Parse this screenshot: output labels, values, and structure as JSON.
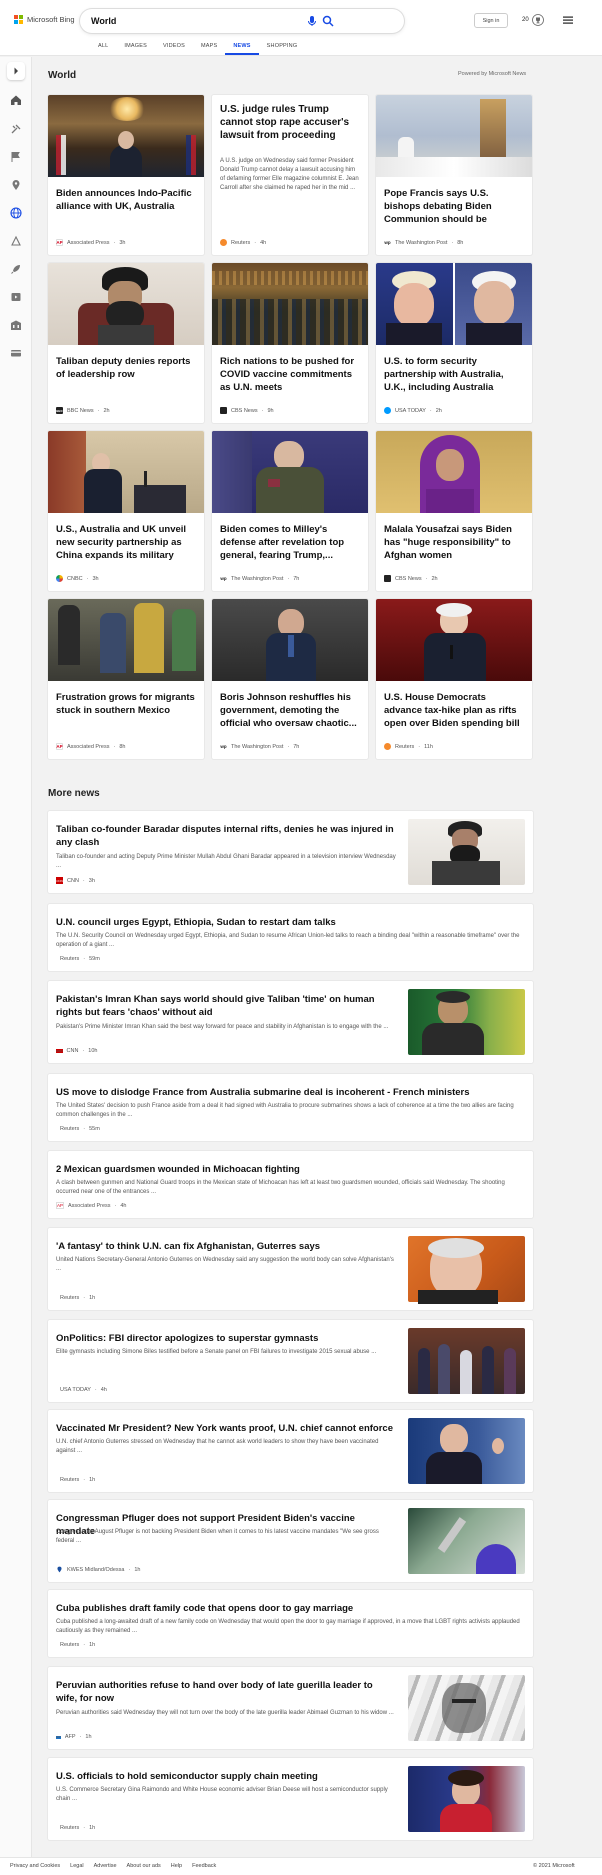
{
  "header": {
    "logo_text": "Microsoft Bing",
    "search_query": "World",
    "signin_label": "Sign in",
    "points": "20",
    "tabs": [
      "ALL",
      "IMAGES",
      "VIDEOS",
      "MAPS",
      "NEWS",
      "SHOPPING"
    ],
    "active_tab": "NEWS"
  },
  "world": {
    "title": "World",
    "powered_by": "Powered by Microsoft News",
    "cards": [
      {
        "title": "Biden announces Indo-Pacific alliance with UK, Australia",
        "source": "Associated Press",
        "age": "3h",
        "logo": "AP",
        "logo_color": "#d6001c",
        "image": "press-conference-photo"
      },
      {
        "title": "U.S. judge rules Trump cannot stop rape accuser's lawsuit from proceeding",
        "snippet": "A U.S. judge on Wednesday said former President Donald Trump cannot delay a lawsuit accusing him of defaming former Elle magazine columnist E. Jean Carroll after she claimed he raped her in the mid ...",
        "source": "Reuters",
        "age": "4h",
        "logo": "R",
        "logo_color": "#f58a2c"
      },
      {
        "title": "Pope Francis says U.S. bishops debating Biden Communion should be pastors, not...",
        "source": "The Washington Post",
        "age": "8h",
        "logo": "wp",
        "logo_color": "#222222",
        "image": "pope-mass-photo"
      },
      {
        "title": "Taliban deputy denies reports of leadership row",
        "source": "BBC News",
        "age": "2h",
        "logo": "BBC",
        "logo_color": "#222222",
        "image": "taliban-deputy-photo"
      },
      {
        "title": "Rich nations to be pushed for COVID vaccine commitments as U.N. meets",
        "source": "CBS News",
        "age": "9h",
        "logo": "cbs",
        "logo_color": "#222222",
        "image": "un-assembly-photo"
      },
      {
        "title": "U.S. to form security partnership with Australia, U.K., including Australia developin...",
        "source": "USA TODAY",
        "age": "2h",
        "logo": "U",
        "logo_color": "#009bff",
        "image": "johnson-biden-photo"
      },
      {
        "title": "U.S., Australia and UK unveil new security partnership as China expands its military and...",
        "source": "CNBC",
        "age": "3h",
        "logo": "N",
        "logo_color": "#ffffff",
        "image": "biden-podium-photo"
      },
      {
        "title": "Biden comes to Milley's defense after revelation top general, fearing Trump,...",
        "source": "The Washington Post",
        "age": "7h",
        "logo": "wp",
        "logo_color": "#222222",
        "image": "milley-photo"
      },
      {
        "title": "Malala Yousafzai says Biden has \"huge responsibility\" to Afghan women",
        "source": "CBS News",
        "age": "2h",
        "logo": "cbs",
        "logo_color": "#222222",
        "image": "malala-photo"
      },
      {
        "title": "Frustration grows for migrants stuck in southern Mexico",
        "source": "Associated Press",
        "age": "8h",
        "logo": "AP",
        "logo_color": "#d6001c",
        "image": "migrants-photo"
      },
      {
        "title": "Boris Johnson reshuffles his government, demoting the official who oversaw chaotic...",
        "source": "The Washington Post",
        "age": "7h",
        "logo": "wp",
        "logo_color": "#222222",
        "image": "raab-photo"
      },
      {
        "title": "U.S. House Democrats advance tax-hike plan as rifts open over Biden spending bill",
        "source": "Reuters",
        "age": "11h",
        "logo": "R",
        "logo_color": "#f58a2c",
        "image": "biden-red-photo"
      }
    ]
  },
  "more_news": {
    "title": "More news",
    "items": [
      {
        "title": "Taliban co-founder Baradar disputes internal rifts, denies he was injured in any clash",
        "snippet": "Taliban co-founder and acting Deputy Prime Minister Mullah Abdul Ghani Baradar appeared in a television interview Wednesday ...",
        "source": "CNN",
        "age": "3h",
        "logo": "CNN",
        "logo_color": "#cc0000",
        "image": "baradar-photo"
      },
      {
        "title": "U.N. council urges Egypt, Ethiopia, Sudan to restart dam talks",
        "snippet": "The U.N. Security Council on Wednesday urged Egypt, Ethiopia, and Sudan to resume African Union-led talks to reach a binding deal \"within a reasonable timeframe\" over the operation of a giant ...",
        "source": "Reuters",
        "age": "59m",
        "logo": "R",
        "logo_color": "#f58a2c"
      },
      {
        "title": "Pakistan's Imran Khan says world should give Taliban 'time' on human rights but fears 'chaos' without aid",
        "snippet": "Pakistan's Prime Minister Imran Khan said the best way forward for peace and stability in Afghanistan is to engage with the ...",
        "source": "CNN",
        "age": "10h",
        "logo": "CNN",
        "logo_color": "#cc0000",
        "image": "imran-khan-photo"
      },
      {
        "title": "US move to dislodge France from Australia submarine deal is incoherent - French ministers",
        "snippet": "The United States' decision to push France aside from a deal it had signed with Australia to procure submarines shows a lack of coherence at a time the two allies are facing common challenges in the ...",
        "source": "Reuters",
        "age": "55m",
        "logo": "R",
        "logo_color": "#f58a2c"
      },
      {
        "title": "2 Mexican guardsmen wounded in Michoacan fighting",
        "snippet": "A clash between gunmen and National Guard troops in the Mexican state of Michoacan has left at least two guardsmen wounded, officials said Wednesday. The shooting occurred near one of the entrances ...",
        "source": "Associated Press",
        "age": "4h",
        "logo": "AP",
        "logo_color": "#d6001c"
      },
      {
        "title": "'A fantasy' to think U.N. can fix Afghanistan, Guterres says",
        "snippet": "United Nations Secretary-General Antonio Guterres on Wednesday said any suggestion the world body can solve Afghanistan's ...",
        "source": "Reuters",
        "age": "1h",
        "logo": "R",
        "logo_color": "#f58a2c",
        "image": "guterres-photo"
      },
      {
        "title": "OnPolitics: FBI director apologizes to superstar gymnasts",
        "snippet": "Elite gymnasts including Simone Biles testified before a Senate panel on FBI failures to investigate 2015 sexual abuse ...",
        "source": "USA TODAY",
        "age": "4h",
        "logo": "U",
        "logo_color": "#009bff",
        "image": "gymnasts-photo"
      },
      {
        "title": "Vaccinated Mr President? New York wants proof, U.N. chief cannot enforce",
        "snippet": "U.N. chief Antonio Guterres stressed on Wednesday that he cannot ask world leaders to show they have been vaccinated against ...",
        "source": "Reuters",
        "age": "1h",
        "logo": "R",
        "logo_color": "#f58a2c",
        "image": "guterres-un-photo"
      },
      {
        "title": "Congressman Pfluger does not support President Biden's vaccine mandate",
        "snippet": "Congressman August Pfluger is not backing President Biden when it comes to his latest vaccine mandates \"We see gross federal ...",
        "source": "KWES Midland/Odessa",
        "age": "1h",
        "logo": "K",
        "logo_color": "#1a4fa0",
        "image": "vaccine-photo"
      },
      {
        "title": "Cuba publishes draft family code that opens door to gay marriage",
        "snippet": "Cuba published a long-awaited draft of a new family code on Wednesday that would open the door to gay marriage if approved, in a move that LGBT rights activists applauded cautiously as they remained ...",
        "source": "Reuters",
        "age": "1h",
        "logo": "R",
        "logo_color": "#f58a2c"
      },
      {
        "title": "Peruvian authorities refuse to hand over body of late guerilla leader to wife, for now",
        "snippet": "Peruvian authorities said Wednesday they will not turn over the body of the late guerilla leader Abimael Guzman to his widow ...",
        "source": "AFP",
        "age": "1h",
        "logo": "AFP",
        "logo_color": "#1a73c8",
        "image": "guzman-photo"
      },
      {
        "title": "U.S. officials to hold semiconductor supply chain meeting",
        "snippet": "U.S. Commerce Secretary Gina Raimondo and White House economic adviser Brian Deese will host a semiconductor supply chain ...",
        "source": "Reuters",
        "age": "1h",
        "logo": "R",
        "logo_color": "#f58a2c",
        "image": "raimondo-photo"
      }
    ]
  },
  "footer": {
    "links": [
      "Privacy and Cookies",
      "Legal",
      "Advertise",
      "About our ads",
      "Help",
      "Feedback"
    ],
    "copyright": "© 2021 Microsoft"
  }
}
